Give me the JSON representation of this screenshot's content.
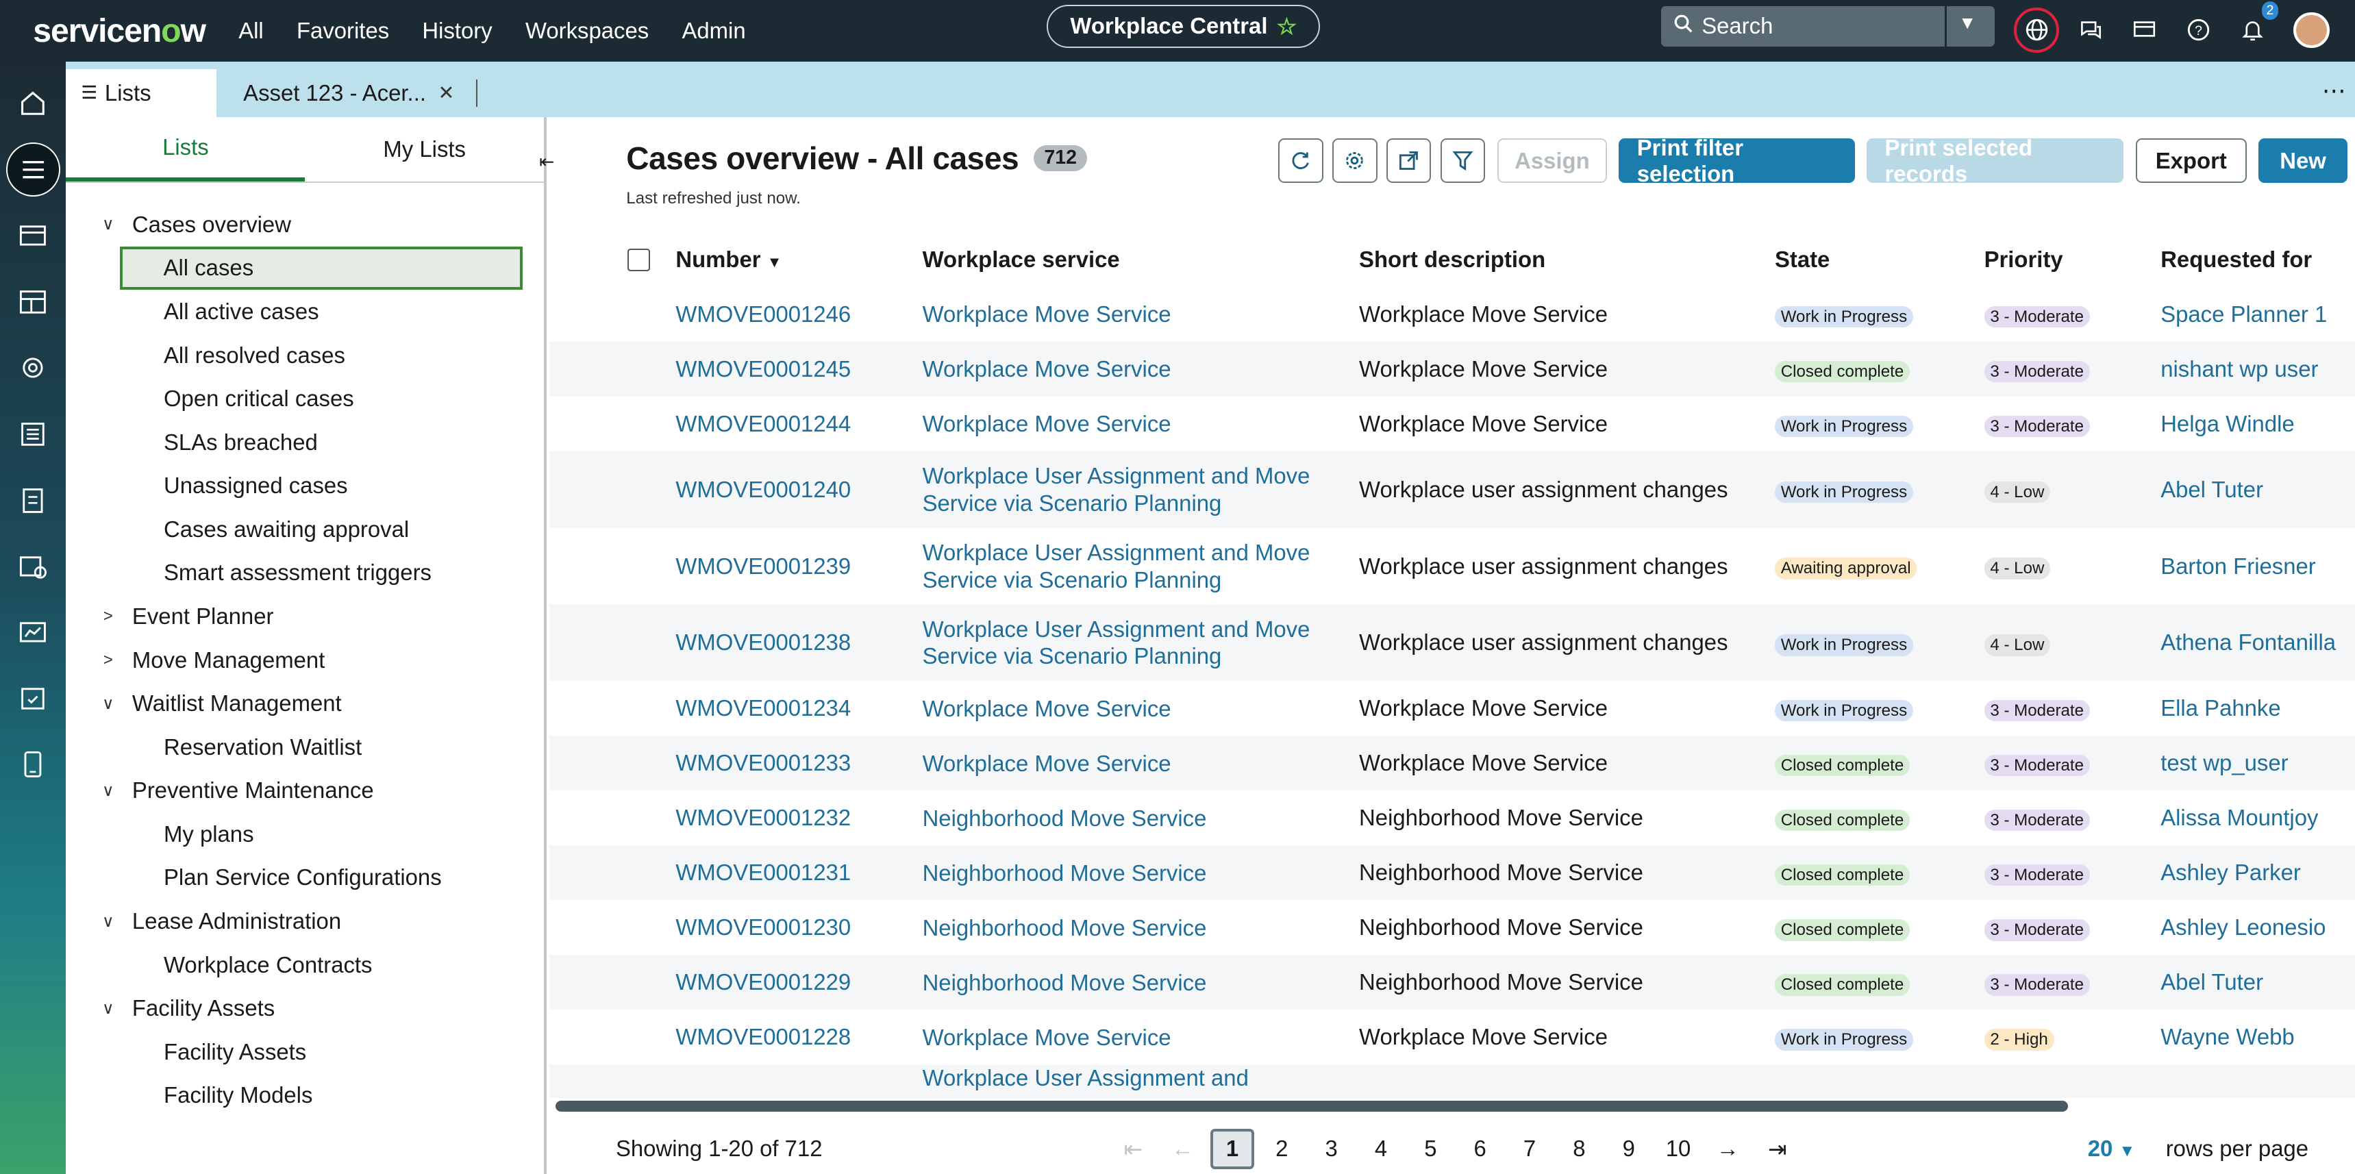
{
  "topbar": {
    "logo": "servicenow",
    "nav": [
      "All",
      "Favorites",
      "History",
      "Workspaces",
      "Admin"
    ],
    "workspace": "Workplace Central",
    "search_placeholder": "Search",
    "notifications_count": "2"
  },
  "tabs": [
    {
      "label": "Lists",
      "active": true
    },
    {
      "label": "Asset 123 - Acer..."
    }
  ],
  "sidebar": {
    "tabs": [
      "Lists",
      "My Lists"
    ],
    "tree": [
      {
        "label": "Cases overview",
        "expanded": true,
        "children": [
          "All cases",
          "All active cases",
          "All resolved cases",
          "Open critical cases",
          "SLAs breached",
          "Unassigned cases",
          "Cases awaiting approval",
          "Smart assessment triggers"
        ]
      },
      {
        "label": "Event Planner",
        "expanded": false,
        "children": []
      },
      {
        "label": "Move Management",
        "expanded": false,
        "children": []
      },
      {
        "label": "Waitlist Management",
        "expanded": true,
        "children": [
          "Reservation Waitlist"
        ]
      },
      {
        "label": "Preventive Maintenance",
        "expanded": true,
        "children": [
          "My plans",
          "Plan Service Configurations"
        ]
      },
      {
        "label": "Lease Administration",
        "expanded": true,
        "children": [
          "Workplace Contracts"
        ]
      },
      {
        "label": "Facility Assets",
        "expanded": true,
        "children": [
          "Facility Assets",
          "Facility Models"
        ]
      }
    ],
    "selected": "All cases"
  },
  "main": {
    "title": "Cases overview - All cases",
    "count": "712",
    "refreshed": "Last refreshed just now.",
    "buttons": {
      "assign": "Assign",
      "print_filter": "Print filter selection",
      "print_selected": "Print selected records",
      "export": "Export",
      "new": "New"
    },
    "columns": [
      "Number",
      "Workplace service",
      "Short description",
      "State",
      "Priority",
      "Requested for"
    ],
    "rows": [
      [
        "WMOVE0001246",
        "Workplace Move Service",
        "Workplace Move Service",
        "Work in Progress",
        "3 - Moderate",
        "Space Planner 1"
      ],
      [
        "WMOVE0001245",
        "Workplace Move Service",
        "Workplace Move Service",
        "Closed complete",
        "3 - Moderate",
        "nishant wp user"
      ],
      [
        "WMOVE0001244",
        "Workplace Move Service",
        "Workplace Move Service",
        "Work in Progress",
        "3 - Moderate",
        "Helga Windle"
      ],
      [
        "WMOVE0001240",
        "Workplace User Assignment and Move Service via Scenario Planning",
        "Workplace user assignment changes",
        "Work in Progress",
        "4 - Low",
        "Abel Tuter"
      ],
      [
        "WMOVE0001239",
        "Workplace User Assignment and Move Service via Scenario Planning",
        "Workplace user assignment changes",
        "Awaiting approval",
        "4 - Low",
        "Barton Friesner"
      ],
      [
        "WMOVE0001238",
        "Workplace User Assignment and Move Service via Scenario Planning",
        "Workplace user assignment changes",
        "Work in Progress",
        "4 - Low",
        "Athena Fontanilla"
      ],
      [
        "WMOVE0001234",
        "Workplace Move Service",
        "Workplace Move Service",
        "Work in Progress",
        "3 - Moderate",
        "Ella Pahnke"
      ],
      [
        "WMOVE0001233",
        "Workplace Move Service",
        "Workplace Move Service",
        "Closed complete",
        "3 - Moderate",
        "test wp_user"
      ],
      [
        "WMOVE0001232",
        "Neighborhood Move Service",
        "Neighborhood Move Service",
        "Closed complete",
        "3 - Moderate",
        "Alissa Mountjoy"
      ],
      [
        "WMOVE0001231",
        "Neighborhood Move Service",
        "Neighborhood Move Service",
        "Closed complete",
        "3 - Moderate",
        "Ashley Parker"
      ],
      [
        "WMOVE0001230",
        "Neighborhood Move Service",
        "Neighborhood Move Service",
        "Closed complete",
        "3 - Moderate",
        "Ashley Leonesio"
      ],
      [
        "WMOVE0001229",
        "Neighborhood Move Service",
        "Neighborhood Move Service",
        "Closed complete",
        "3 - Moderate",
        "Abel Tuter"
      ],
      [
        "WMOVE0001228",
        "Workplace Move Service",
        "Workplace Move Service",
        "Work in Progress",
        "2 - High",
        "Wayne Webb"
      ],
      [
        "",
        "Workplace User Assignment and",
        "",
        "",
        "",
        ""
      ]
    ],
    "pager": {
      "showing": "Showing 1-20 of 712",
      "pages": [
        "1",
        "2",
        "3",
        "4",
        "5",
        "6",
        "7",
        "8",
        "9",
        "10"
      ],
      "current": "1",
      "rows_per_page": "20",
      "rows_label": "rows per page"
    }
  }
}
